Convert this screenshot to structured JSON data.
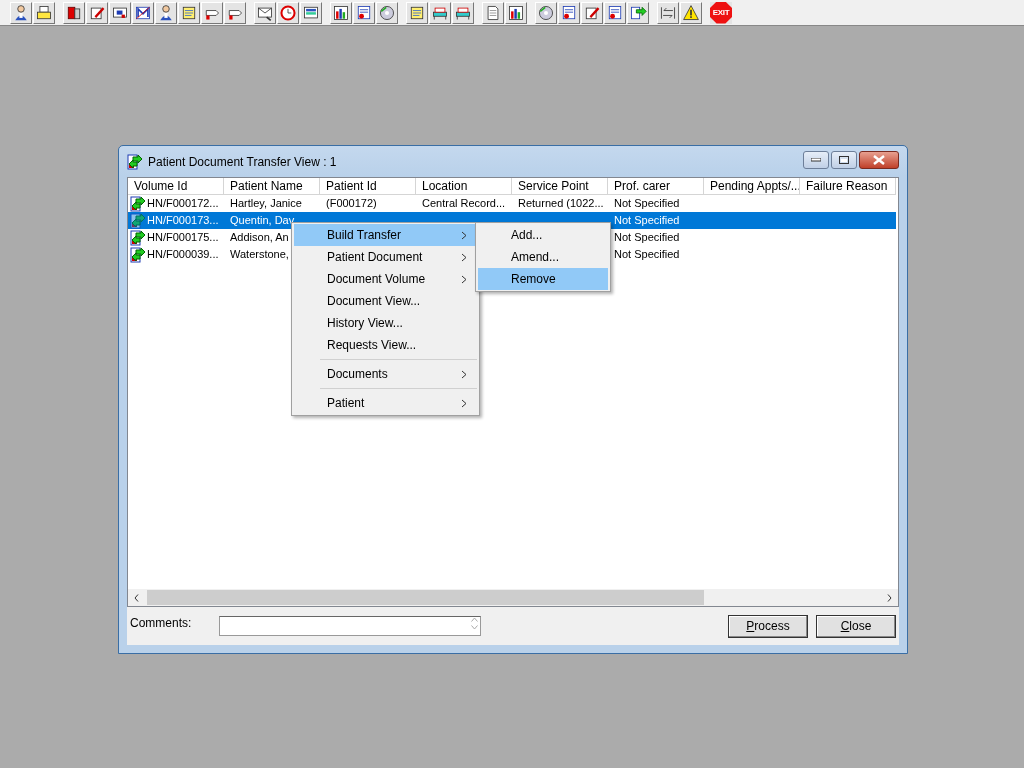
{
  "toolbar": [
    [
      {
        "kind": "person"
      },
      {
        "kind": "printer"
      }
    ],
    [
      {
        "kind": "book"
      },
      {
        "kind": "pen"
      },
      {
        "kind": "card"
      },
      {
        "kind": "mail"
      },
      {
        "kind": "person"
      },
      {
        "kind": "note"
      },
      {
        "kind": "hand"
      },
      {
        "kind": "hand"
      }
    ],
    [
      {
        "kind": "envelope"
      },
      {
        "kind": "clock"
      },
      {
        "kind": "screen"
      }
    ],
    [
      {
        "kind": "chart"
      },
      {
        "kind": "form"
      },
      {
        "kind": "disc"
      }
    ],
    [
      {
        "kind": "note"
      },
      {
        "kind": "bed"
      },
      {
        "kind": "bed"
      }
    ],
    [
      {
        "kind": "page"
      },
      {
        "kind": "chart"
      }
    ],
    [
      {
        "kind": "disc"
      },
      {
        "kind": "form"
      },
      {
        "kind": "pen"
      },
      {
        "kind": "form"
      },
      {
        "kind": "transfer"
      }
    ],
    [
      {
        "kind": "arrows"
      },
      {
        "kind": "warning"
      }
    ],
    [
      {
        "kind": "exit",
        "label": "EXIT"
      }
    ]
  ],
  "window": {
    "title": "Patient Document Transfer View : 1",
    "columns": [
      "Volume Id",
      "Patient Name",
      "Patient Id",
      "Location",
      "Service Point",
      "Prof. carer",
      "Pending Appts/...",
      "Failure Reason"
    ],
    "rows": [
      {
        "selected": false,
        "cells": [
          "HN/F000172...",
          "Hartley, Janice",
          "(F000172)",
          "Central Record...",
          "Returned (1022...",
          "Not Specified"
        ]
      },
      {
        "selected": true,
        "cells": [
          "HN/F000173...",
          "Quentin, Dav",
          null,
          null,
          null,
          "Not Specified"
        ]
      },
      {
        "selected": false,
        "cells": [
          "HN/F000175...",
          "Addison, An",
          null,
          null,
          null,
          "Not Specified"
        ]
      },
      {
        "selected": false,
        "cells": [
          "HN/F000039...",
          "Waterstone,",
          null,
          null,
          null,
          "Not Specified"
        ]
      }
    ],
    "comments_label": "Comments:",
    "buttons": [
      "Process",
      "Close"
    ]
  },
  "context_menu": [
    {
      "label": "Build Transfer",
      "submenu": true,
      "selected": true,
      "separator_before": false
    },
    {
      "label": "Patient Document",
      "submenu": true,
      "selected": false,
      "separator_before": false
    },
    {
      "label": "Document Volume",
      "submenu": true,
      "selected": false,
      "separator_before": false
    },
    {
      "label": "Document View...",
      "submenu": false,
      "selected": false,
      "separator_before": false
    },
    {
      "label": "History View...",
      "submenu": false,
      "selected": false,
      "separator_before": false
    },
    {
      "label": "Requests View...",
      "submenu": false,
      "selected": false,
      "separator_before": false
    },
    {
      "label": "Documents",
      "submenu": true,
      "selected": false,
      "separator_before": true
    },
    {
      "label": "Patient",
      "submenu": true,
      "selected": false,
      "separator_before": true
    }
  ],
  "submenu": [
    {
      "label": "Add...",
      "selected": false
    },
    {
      "label": "Amend...",
      "selected": false
    },
    {
      "label": "Remove",
      "selected": true
    }
  ]
}
